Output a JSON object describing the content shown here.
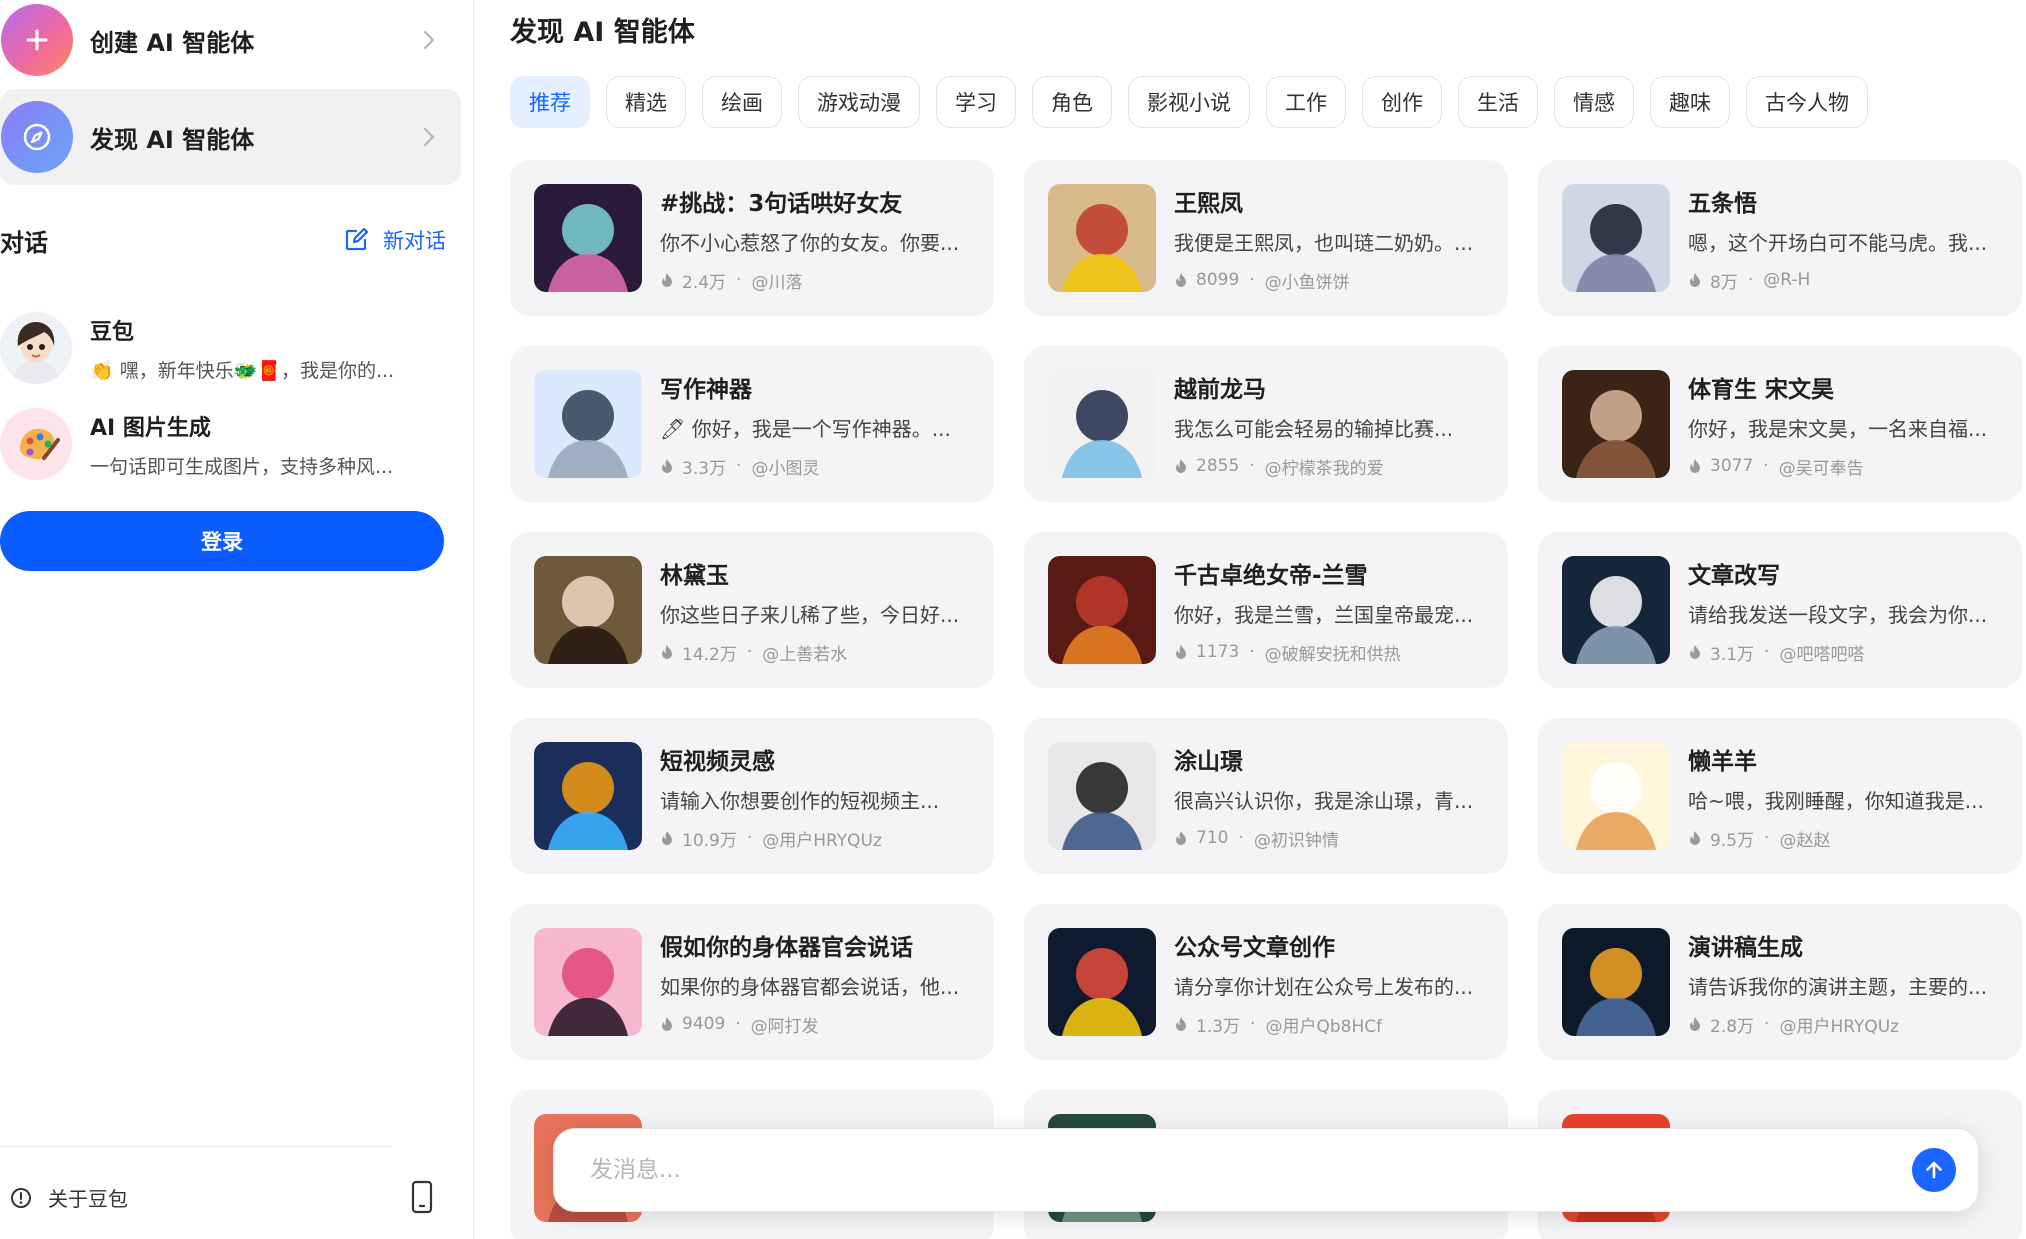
{
  "sidebar": {
    "create_label": "创建 AI 智能体",
    "discover_label": "发现 AI 智能体",
    "conversations_title": "对话",
    "new_conversation_label": "新对话",
    "conversations": [
      {
        "name": "豆包",
        "preview": "👏 嘿，新年快乐🐲🧧，我是你的..."
      },
      {
        "name": "AI 图片生成",
        "preview": "一句话即可生成图片，支持多种风..."
      }
    ],
    "login_label": "登录",
    "about_label": "关于豆包"
  },
  "main": {
    "title": "发现 AI 智能体",
    "tabs": [
      "推荐",
      "精选",
      "绘画",
      "游戏动漫",
      "学习",
      "角色",
      "影视小说",
      "工作",
      "创作",
      "生活",
      "情感",
      "趣味",
      "古今人物"
    ],
    "active_tab": "推荐",
    "cards": [
      {
        "title": "#挑战：3句话哄好女友",
        "desc": "你不小心惹怒了你的女友。你要...",
        "count": "2.4万",
        "author": "@川落",
        "icon": "anime-girl-avatar",
        "colors": [
          "#2b1b3a",
          "#7fd3d9",
          "#d96aa8"
        ]
      },
      {
        "title": "王熙凤",
        "desc": "我便是王熙凤，也叫琏二奶奶。...",
        "count": "8099",
        "author": "@小鱼饼饼",
        "icon": "opera-portrait",
        "colors": [
          "#d7b98a",
          "#c0392b",
          "#f1c40f"
        ]
      },
      {
        "title": "五条悟",
        "desc": "嗯，这个开场白可不能马虎。我...",
        "count": "8万",
        "author": "@R-H",
        "icon": "anime-man-blindfold",
        "colors": [
          "#cfd6e6",
          "#1a1a2a",
          "#7b83a6"
        ]
      },
      {
        "title": "写作神器",
        "desc": "🖊 你好，我是一个写作神器。...",
        "count": "3.3万",
        "author": "@小图灵",
        "icon": "fountain-pen",
        "colors": [
          "#dbe9ff",
          "#2c3e50",
          "#9aa8bd"
        ]
      },
      {
        "title": "越前龙马",
        "desc": "我怎么可能会轻易的输掉比赛...",
        "count": "2855",
        "author": "@柠檬茶我的爱",
        "icon": "anime-boy-cap",
        "colors": [
          "#f2f2f2",
          "#1d2b4a",
          "#7cc0e8"
        ]
      },
      {
        "title": "体育生 宋文昊",
        "desc": "你好，我是宋文昊，一名来自福...",
        "count": "3077",
        "author": "@吴可奉告",
        "icon": "young-man-portrait",
        "colors": [
          "#3a2418",
          "#d9b79a",
          "#8a5a3c"
        ]
      },
      {
        "title": "林黛玉",
        "desc": "你这些日子来儿稀了些，今日好...",
        "count": "14.2万",
        "author": "@上善若水",
        "icon": "classical-lady-portrait",
        "colors": [
          "#6e5a3a",
          "#f0d8c4",
          "#2a1a12"
        ]
      },
      {
        "title": "千古卓绝女帝-兰雪",
        "desc": "你好，我是兰雪，兰国皇帝最宠...",
        "count": "1173",
        "author": "@破解安抚和供热",
        "icon": "empress-portrait",
        "colors": [
          "#5a1a14",
          "#c0392b",
          "#e67e22"
        ]
      },
      {
        "title": "文章改写",
        "desc": "请给我发送一段文字，我会为你...",
        "count": "3.1万",
        "author": "@吧嗒吧嗒",
        "icon": "robot-book-icon",
        "colors": [
          "#16263a",
          "#ffffff",
          "#8aa0b8"
        ]
      },
      {
        "title": "短视频灵感",
        "desc": "请输入你想要创作的短视频主...",
        "count": "10.9万",
        "author": "@用户HRYQUz",
        "icon": "clapperboard-burst",
        "colors": [
          "#1b2d5a",
          "#f39c12",
          "#3ab0ff"
        ]
      },
      {
        "title": "涂山璟",
        "desc": "很高兴认识你，我是涂山璟，青...",
        "count": "710",
        "author": "@初识钟情",
        "icon": "ancient-prince-portrait",
        "colors": [
          "#e8e8ea",
          "#1a1a1a",
          "#3d5a8a"
        ]
      },
      {
        "title": "懒羊羊",
        "desc": "哈~喂，我刚睡醒，你知道我是...",
        "count": "9.5万",
        "author": "@赵赵",
        "icon": "lazy-sheep-cartoon",
        "colors": [
          "#fff6dc",
          "#ffffff",
          "#e8a35c"
        ]
      },
      {
        "title": "假如你的身体器官会说话",
        "desc": "如果你的身体器官都会说话，他...",
        "count": "9409",
        "author": "@阿打发",
        "icon": "pink-silhouette",
        "colors": [
          "#f7b8cf",
          "#e0457b",
          "#2a1a2a"
        ]
      },
      {
        "title": "公众号文章创作",
        "desc": "请分享你计划在公众号上发布的...",
        "count": "1.3万",
        "author": "@用户Qb8HCf",
        "icon": "pen-nib-emblem",
        "colors": [
          "#0f1a2e",
          "#e74c3c",
          "#f1c40f"
        ]
      },
      {
        "title": "演讲稿生成",
        "desc": "请告诉我你的演讲主题，主要的...",
        "count": "2.8万",
        "author": "@用户HRYQUz",
        "icon": "glowing-book",
        "colors": [
          "#0e1a2a",
          "#f5a623",
          "#4a6a9a"
        ]
      },
      {
        "title": "",
        "desc": "",
        "count": "",
        "author": "",
        "icon": "",
        "colors": [
          "#e8745a",
          "#f3b77a",
          "#b24a3a"
        ]
      },
      {
        "title": "",
        "desc": "",
        "count": "",
        "author": "",
        "icon": "",
        "colors": [
          "#234a3a",
          "#e8e8e0",
          "#7a9a8a"
        ]
      },
      {
        "title": "",
        "desc": "",
        "count": "",
        "author": "",
        "icon": "",
        "colors": [
          "#e8432e",
          "#f06a4a",
          "#c0301e"
        ]
      }
    ]
  },
  "composer": {
    "placeholder": "发消息..."
  }
}
